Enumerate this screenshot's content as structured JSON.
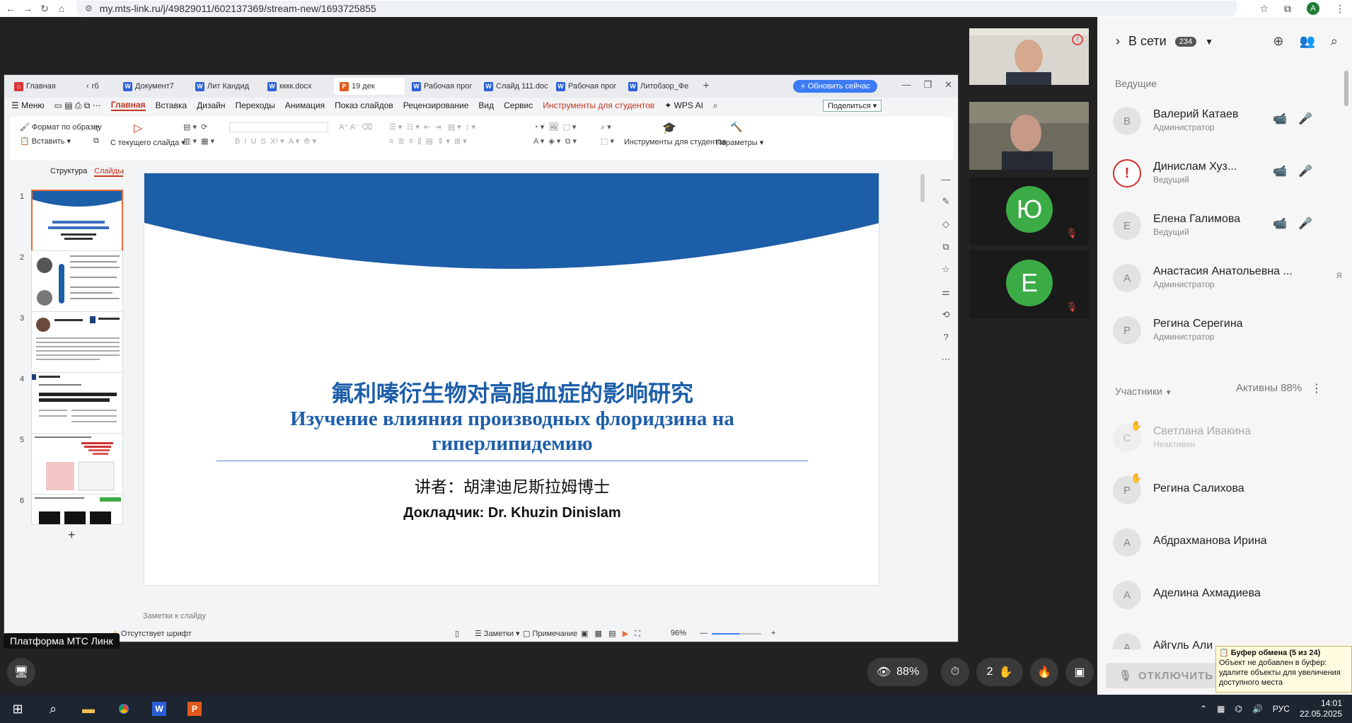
{
  "browser": {
    "url": "my.mts-link.ru/j/49829011/602137369/stream-new/1693725855",
    "account_initial": "A"
  },
  "wps": {
    "tabs": [
      {
        "icon": "home-icon",
        "label": "Главная"
      },
      {
        "icon": "arrow-icon",
        "label": "rб"
      },
      {
        "icon": "W",
        "label": "Документ7"
      },
      {
        "icon": "W",
        "label": "Лит Кандид"
      },
      {
        "icon": "W",
        "label": "кккк.docx"
      },
      {
        "icon": "P",
        "label": "19 дек"
      },
      {
        "icon": "W",
        "label": "Рабочая прог"
      },
      {
        "icon": "W",
        "label": "Слайд 111.doc"
      },
      {
        "icon": "W",
        "label": "Рабочая прог"
      },
      {
        "icon": "W",
        "label": "Литобзор_Фе"
      }
    ],
    "update_button": "Обновить сейчас",
    "menu": {
      "menu_label": "Меню",
      "items": [
        "Главная",
        "Вставка",
        "Дизайн",
        "Переходы",
        "Анимация",
        "Показ слайдов",
        "Рецензирование",
        "Вид",
        "Сервис"
      ],
      "student_tools": "Инструменты для студентов",
      "wps_ai": "WPS AI",
      "share": "Поделиться"
    },
    "ribbon": {
      "format_painter": "Формат по образцу",
      "paste": "Вставить",
      "from_current": "С текущего слайда",
      "student_tools": "Инструменты для студентов",
      "params": "Параметры"
    },
    "panel_tabs": {
      "structure": "Структура",
      "slides": "Слайды"
    },
    "slide_numbers": [
      "1",
      "2",
      "3",
      "4",
      "5",
      "6"
    ],
    "slide": {
      "title_cn": "氟利嗪衍生物对高脂血症的影响研究",
      "title_ru": "Изучение влияния производных флоридзина на гиперлипидемию",
      "lecturer_cn": "讲者：胡津迪尼斯拉姆博士",
      "lecturer_en": "Докладчик: Dr. Khuzin Dinislam"
    },
    "notes_placeholder": "Заметки к слайду",
    "status": {
      "missing_font": "Отсутствует шрифт",
      "notes": "Заметки",
      "comment": "Примечание",
      "zoom": "96%",
      "zoom_fraction": 0.55
    }
  },
  "video_tiles": [
    {
      "type": "video"
    },
    {
      "type": "video"
    },
    {
      "type": "avatar",
      "letter": "Ю"
    },
    {
      "type": "avatar",
      "letter": "Е"
    }
  ],
  "participants": {
    "header": "В сети",
    "count": "234",
    "hosts_section": "Ведущие",
    "hosts": [
      {
        "initial": "В",
        "name": "Валерий Катаев",
        "role": "Администратор"
      },
      {
        "initial": "!",
        "name": "Динислам Хуз...",
        "role": "Ведущий"
      },
      {
        "initial": "Е",
        "name": "Елена Галимова",
        "role": "Ведущий"
      },
      {
        "initial": "А",
        "name": "Анастасия Анатольевна ...",
        "role": "Администратор",
        "extra": "я"
      },
      {
        "initial": "Р",
        "name": "Регина Серегина",
        "role": "Администратор"
      }
    ],
    "members_section": "Участники",
    "active": "Активны 88%",
    "members": [
      {
        "initial": "С",
        "name": "Светлана Ивакина",
        "role": "Неактивен"
      },
      {
        "initial": "Р",
        "name": "Регина Салихова",
        "role": ""
      },
      {
        "initial": "А",
        "name": "Абдрахманова Ирина",
        "role": ""
      },
      {
        "initial": "А",
        "name": "Аделина Ахмадиева",
        "role": ""
      },
      {
        "initial": "А",
        "name": "Айгуль Али",
        "role": ""
      }
    ],
    "disconnect": "ОТКЛЮЧИТЬ"
  },
  "clipboard": {
    "title": "Буфер обмена (5 из 24)",
    "message": "Объект не добавлен в буфер: удалите объекты для увеличения доступного места"
  },
  "stage": {
    "platform_label": "Платформа МТС Линк",
    "attendance": "88%",
    "hands": "2"
  },
  "taskbar": {
    "lang": "РУС",
    "time": "14:01",
    "date": "22.05.2025"
  },
  "colors": {
    "accent": "#1d5ea8",
    "wps_red": "#c4351f",
    "avatar_green": "#3bab46",
    "alert_red": "#d32f2f"
  }
}
